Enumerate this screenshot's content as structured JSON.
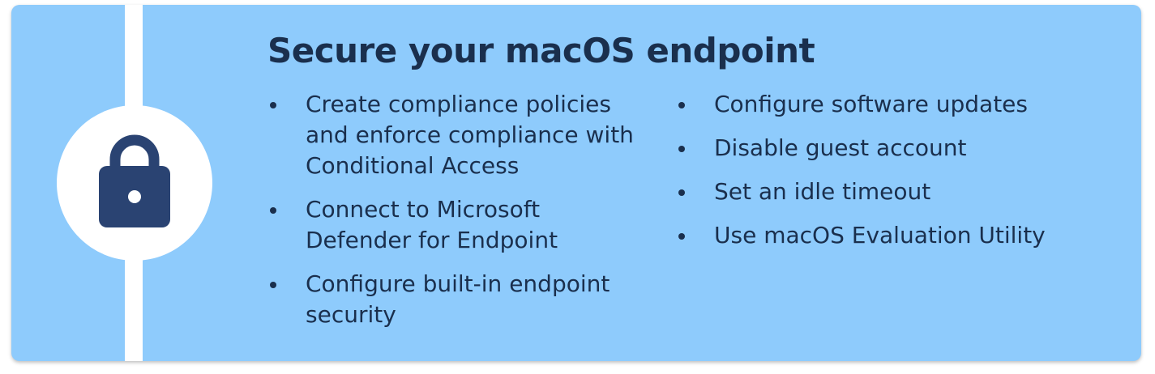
{
  "colors": {
    "card_background": "#8ecbfc",
    "text": "#1a2f4d",
    "lock_icon": "#2a4372",
    "accent_line": "#ffffff"
  },
  "icon": "lock-icon",
  "title": "Secure your macOS endpoint",
  "left_items": [
    "Create compliance policies and enforce compliance with Conditional Access",
    "Connect to Microsoft Defender for Endpoint",
    "Configure built-in endpoint security"
  ],
  "right_items": [
    "Configure software updates",
    "Disable guest account",
    "Set an idle timeout",
    "Use macOS Evaluation Utility"
  ]
}
